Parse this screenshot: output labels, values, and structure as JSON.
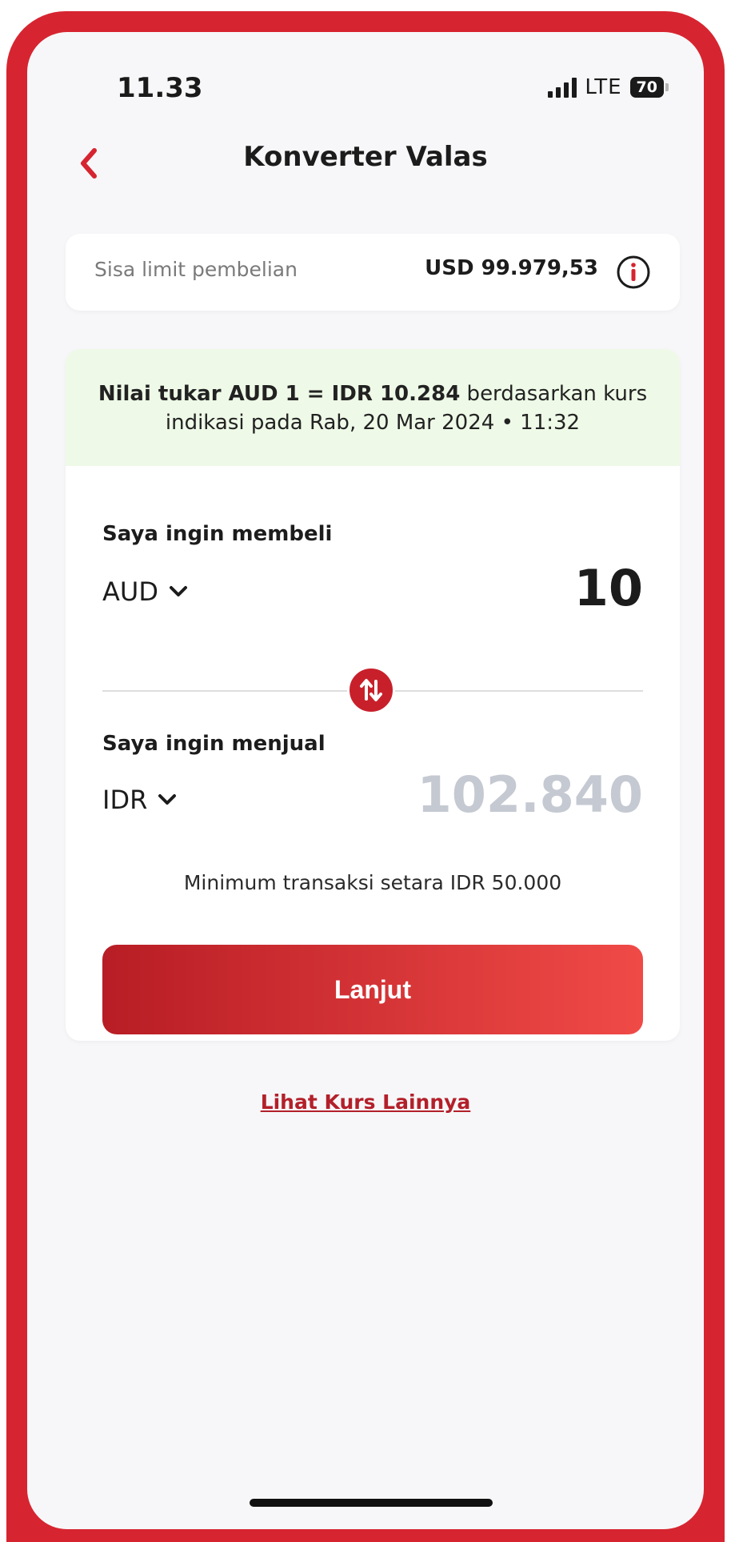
{
  "status_bar": {
    "time": "11.33",
    "network": "LTE",
    "battery": "70"
  },
  "header": {
    "title": "Konverter Valas",
    "back_icon": "chevron-left-icon"
  },
  "limit": {
    "label": "Sisa limit pembelian",
    "value": "USD 99.979,53",
    "info_icon": "info-icon"
  },
  "rate_banner": {
    "bold_text": "Nilai tukar AUD 1 = IDR 10.284",
    "text_line1_rest": " berdasarkan kurs",
    "text_line2": "indikasi pada Rab, 20 Mar 2024 • 11:32"
  },
  "buy": {
    "label": "Saya ingin membeli",
    "currency": "AUD",
    "amount": "10"
  },
  "sell": {
    "label": "Saya ingin menjual",
    "currency": "IDR",
    "amount": "102.840"
  },
  "minimum_note": "Minimum transaksi setara IDR 50.000",
  "continue_label": "Lanjut",
  "more_rates_link": "Lihat Kurs Lainnya",
  "colors": {
    "accent": "#d62530",
    "banner_bg": "#eef9e7",
    "amount_placeholder": "#c5c9d2"
  }
}
